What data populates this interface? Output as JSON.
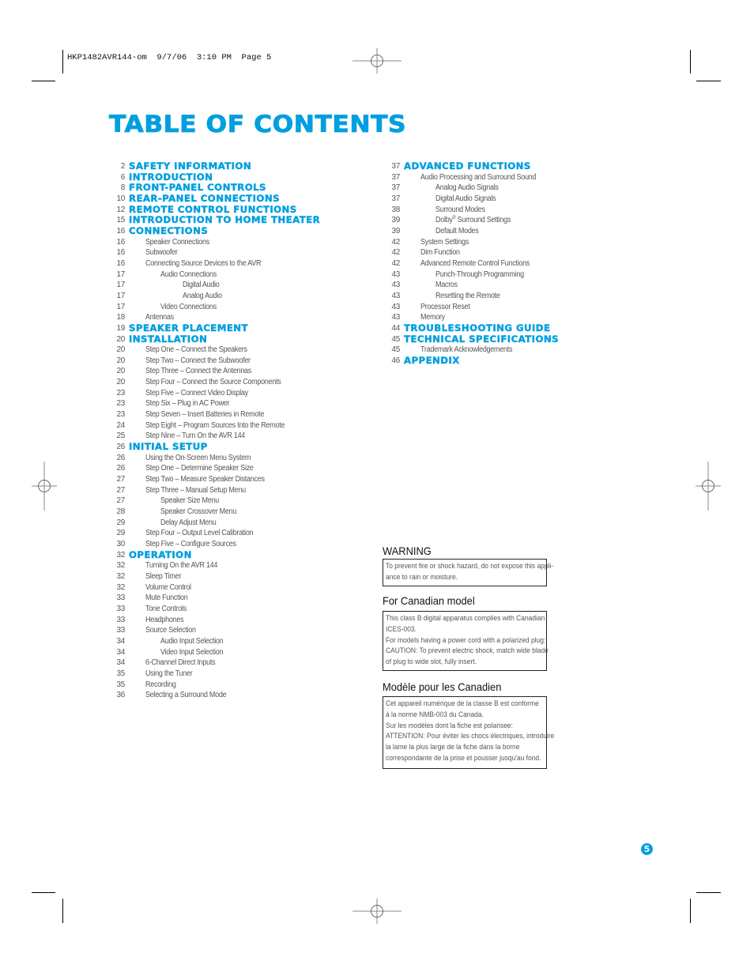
{
  "slug": "HKP1482AVR144-om  9/7/06  3:10 PM  Page 5",
  "title": "TABLE OF CONTENTS",
  "page_number": "5",
  "accent_color": "#009fdf",
  "toc_left": [
    {
      "page": "2",
      "label": "SAFETY INFORMATION",
      "level": 0
    },
    {
      "page": "6",
      "label": "INTRODUCTION",
      "level": 0
    },
    {
      "page": "8",
      "label": "FRONT-PANEL CONTROLS",
      "level": 0
    },
    {
      "page": "10",
      "label": "REAR-PANEL CONNECTIONS",
      "level": 0
    },
    {
      "page": "12",
      "label": "REMOTE CONTROL FUNCTIONS",
      "level": 0
    },
    {
      "page": "15",
      "label": "INTRODUCTION TO HOME THEATER",
      "level": 0
    },
    {
      "page": "16",
      "label": "CONNECTIONS",
      "level": 0
    },
    {
      "page": "16",
      "label": "Speaker Connections",
      "level": 1
    },
    {
      "page": "16",
      "label": "Subwoofer",
      "level": 1
    },
    {
      "page": "16",
      "label": "Connecting Source Devices to the AVR",
      "level": 1
    },
    {
      "page": "17",
      "label": "Audio Connections",
      "level": 2
    },
    {
      "page": "17",
      "label": "Digital Audio",
      "level": 3
    },
    {
      "page": "17",
      "label": "Analog Audio",
      "level": 3
    },
    {
      "page": "17",
      "label": "Video Connections",
      "level": 2
    },
    {
      "page": "18",
      "label": "Antennas",
      "level": 1
    },
    {
      "page": "19",
      "label": "SPEAKER PLACEMENT",
      "level": 0
    },
    {
      "page": "20",
      "label": "INSTALLATION",
      "level": 0
    },
    {
      "page": "20",
      "label": "Step One – Connect the Speakers",
      "level": 1
    },
    {
      "page": "20",
      "label": "Step Two – Connect the Subwoofer",
      "level": 1
    },
    {
      "page": "20",
      "label": "Step Three – Connect the Antennas",
      "level": 1
    },
    {
      "page": "20",
      "label": "Step Four – Connect the Source Components",
      "level": 1
    },
    {
      "page": "23",
      "label": "Step Five – Connect Video Display",
      "level": 1
    },
    {
      "page": "23",
      "label": "Step Six – Plug in AC Power",
      "level": 1
    },
    {
      "page": "23",
      "label": "Step Seven – Insert Batteries in Remote",
      "level": 1
    },
    {
      "page": "24",
      "label": "Step Eight – Program Sources Into the Remote",
      "level": 1
    },
    {
      "page": "25",
      "label": "Step Nine – Turn On the AVR 144",
      "level": 1
    },
    {
      "page": "26",
      "label": "INITIAL SETUP",
      "level": 0
    },
    {
      "page": "26",
      "label": "Using the On-Screen Menu System",
      "level": 1
    },
    {
      "page": "26",
      "label": "Step One – Determine Speaker Size",
      "level": 1
    },
    {
      "page": "27",
      "label": "Step Two – Measure Speaker Distances",
      "level": 1
    },
    {
      "page": "27",
      "label": "Step Three – Manual Setup Menu",
      "level": 1
    },
    {
      "page": "27",
      "label": "Speaker Size Menu",
      "level": 2
    },
    {
      "page": "28",
      "label": "Speaker Crossover Menu",
      "level": 2
    },
    {
      "page": "29",
      "label": "Delay Adjust Menu",
      "level": 2
    },
    {
      "page": "29",
      "label": "Step Four – Output Level Calibration",
      "level": 1
    },
    {
      "page": "30",
      "label": "Step Five – Configure Sources",
      "level": 1
    },
    {
      "page": "32",
      "label": "OPERATION",
      "level": 0
    },
    {
      "page": "32",
      "label": "Turning On the AVR 144",
      "level": 1
    },
    {
      "page": "32",
      "label": "Sleep Timer",
      "level": 1
    },
    {
      "page": "32",
      "label": "Volume Control",
      "level": 1
    },
    {
      "page": "33",
      "label": "Mute Function",
      "level": 1
    },
    {
      "page": "33",
      "label": "Tone Controls",
      "level": 1
    },
    {
      "page": "33",
      "label": "Headphones",
      "level": 1
    },
    {
      "page": "33",
      "label": "Source Selection",
      "level": 1
    },
    {
      "page": "34",
      "label": "Audio Input Selection",
      "level": 2
    },
    {
      "page": "34",
      "label": "Video Input Selection",
      "level": 2
    },
    {
      "page": "34",
      "label": "6-Channel Direct Inputs",
      "level": 1
    },
    {
      "page": "35",
      "label": "Using the Tuner",
      "level": 1
    },
    {
      "page": "35",
      "label": "Recording",
      "level": 1
    },
    {
      "page": "36",
      "label": "Selecting a Surround Mode",
      "level": 1
    }
  ],
  "toc_right": [
    {
      "page": "37",
      "label": "ADVANCED FUNCTIONS",
      "level": 0
    },
    {
      "page": "37",
      "label": "Audio Processing and Surround Sound",
      "level": 1
    },
    {
      "page": "37",
      "label": "Analog Audio Signals",
      "level": 2
    },
    {
      "page": "37",
      "label": "Digital Audio Signals",
      "level": 2
    },
    {
      "page": "38",
      "label": "Surround Modes",
      "level": 2
    },
    {
      "page": "39",
      "label": "Dolby",
      "sup": "®",
      "label_after": " Surround Settings",
      "level": 2
    },
    {
      "page": "39",
      "label": "Default Modes",
      "level": 2
    },
    {
      "page": "42",
      "label": "System Settings",
      "level": 1
    },
    {
      "page": "42",
      "label": "Dim Function",
      "level": 1
    },
    {
      "page": "42",
      "label": "Advanced Remote Control Functions",
      "level": 1
    },
    {
      "page": "43",
      "label": "Punch-Through Programming",
      "level": 2
    },
    {
      "page": "43",
      "label": "Macros",
      "level": 2
    },
    {
      "page": "43",
      "label": "Resetting the Remote",
      "level": 2
    },
    {
      "page": "43",
      "label": "Processor Reset",
      "level": 1
    },
    {
      "page": "43",
      "label": "Memory",
      "level": 1
    },
    {
      "page": "44",
      "label": "TROUBLESHOOTING GUIDE",
      "level": 0
    },
    {
      "page": "45",
      "label": "TECHNICAL SPECIFICATIONS",
      "level": 0
    },
    {
      "page": "45",
      "label": "Trademark Acknowledgements",
      "level": 1
    },
    {
      "page": "46",
      "label": "APPENDIX",
      "level": 0
    }
  ],
  "notices": [
    {
      "heading": "WARNING",
      "lines": [
        "To prevent fire or shock hazard, do not expose this appli-",
        "ance to rain or moisture."
      ]
    },
    {
      "heading": "For Canadian model",
      "lines": [
        "This class B digital apparatus complies with Canadian",
        "ICES-003.",
        "For models having a power cord with a polarized plug:",
        "CAUTION: To prevent electric shock, match wide blade",
        "of plug to wide slot, fully insert."
      ]
    },
    {
      "heading": "Modèle pour les Canadien",
      "lines": [
        "Cet appareil numérique de la classe B est conforme",
        "à la norme NMB-003 du Canada.",
        "Sur les modèles dont la fiche est polarisee:",
        "ATTENTION: Pour éviter les chocs électriques, introduire",
        "la lame la plus large de la fiche dans la borne",
        "correspondante de la prise et pousser jusqu'au fond."
      ]
    }
  ]
}
